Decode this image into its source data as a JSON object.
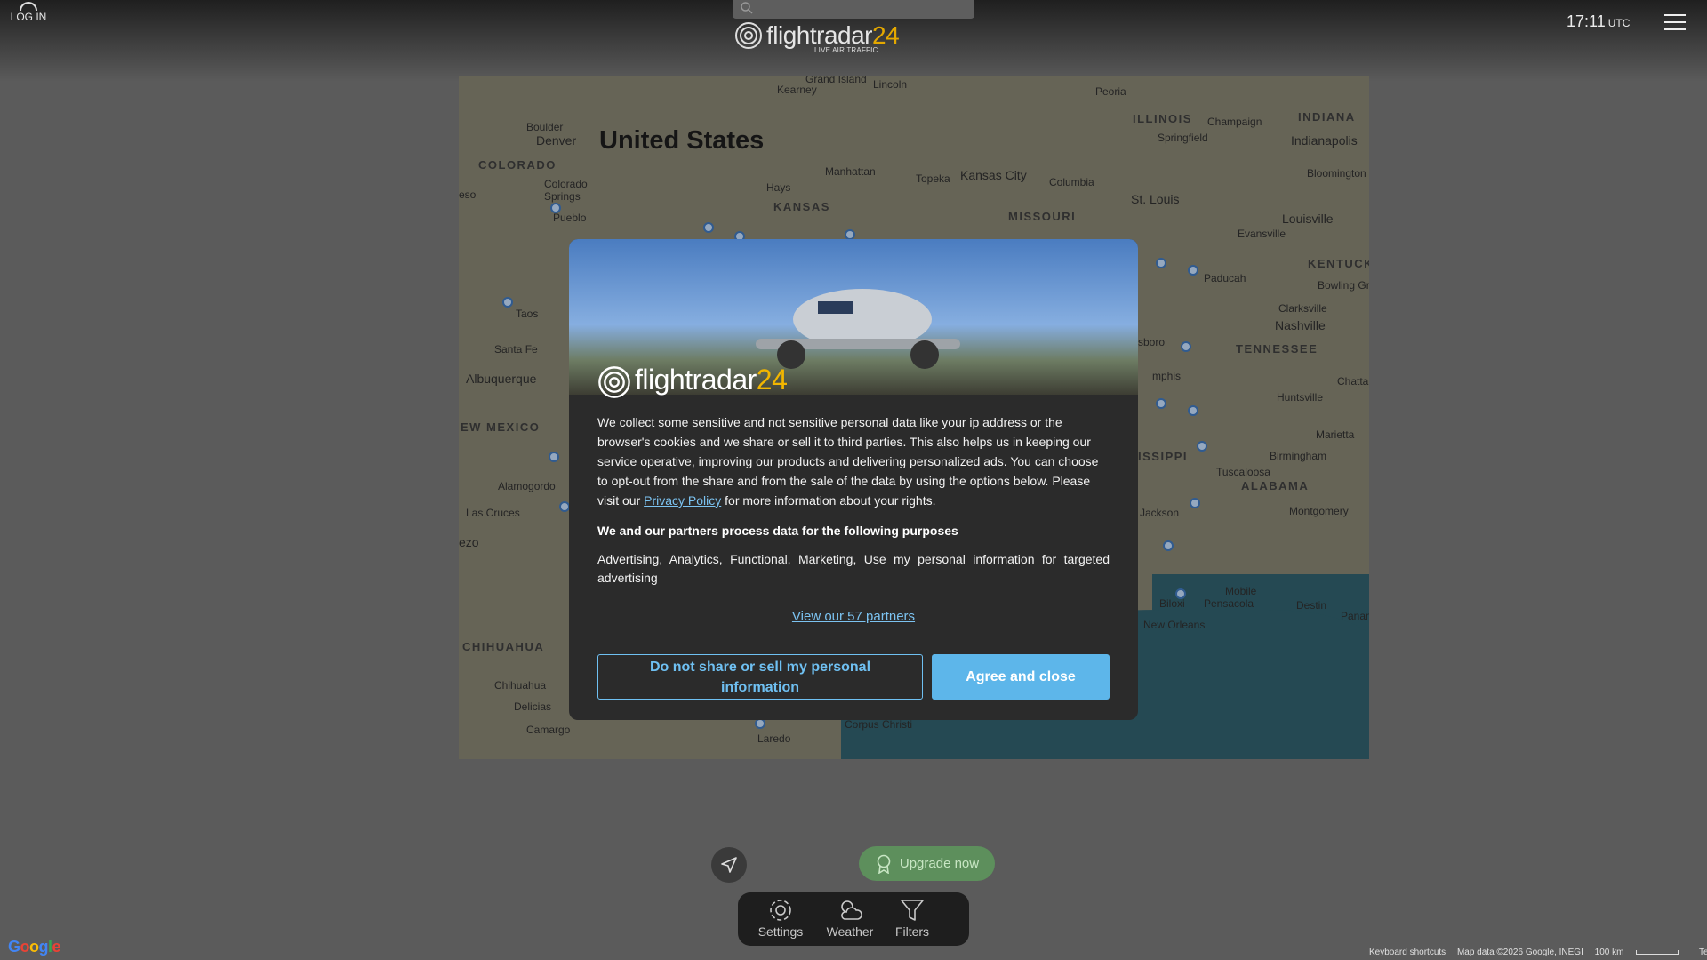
{
  "header": {
    "login_label": "LOG IN",
    "search": {
      "placeholder": ""
    },
    "logo": {
      "word": "flightradar",
      "number": "24",
      "subtitle": "LIVE AIR TRAFFIC"
    },
    "clock": {
      "time": "17:11",
      "timezone": "UTC"
    }
  },
  "map": {
    "country": "United States",
    "states": [
      {
        "name": "COLORADO"
      },
      {
        "name": "KANSAS"
      },
      {
        "name": "MISSOURI"
      },
      {
        "name": "ILLINOIS"
      },
      {
        "name": "INDIANA"
      },
      {
        "name": "KENTUCK"
      },
      {
        "name": "TENNESSEE"
      },
      {
        "name": "EW MEXICO"
      },
      {
        "name": "ISSIPPI"
      },
      {
        "name": "ALABAMA"
      },
      {
        "name": "CHIHUAHUA"
      }
    ],
    "cities": [
      {
        "name": "Grand Island"
      },
      {
        "name": "Kearney"
      },
      {
        "name": "Lincoln"
      },
      {
        "name": "Peoria"
      },
      {
        "name": "Champaign"
      },
      {
        "name": "Boulder"
      },
      {
        "name": "Denver"
      },
      {
        "name": "Springfield"
      },
      {
        "name": "Indianapolis"
      },
      {
        "name": "Manhattan"
      },
      {
        "name": "Kansas City"
      },
      {
        "name": "Topeka"
      },
      {
        "name": "Columbia"
      },
      {
        "name": "Bloomington"
      },
      {
        "name": "Colorado Springs"
      },
      {
        "name": "Hays"
      },
      {
        "name": "St. Louis"
      },
      {
        "name": "Louisville"
      },
      {
        "name": "Pueblo"
      },
      {
        "name": "Evansville"
      },
      {
        "name": "Paducah"
      },
      {
        "name": "Bowling Green"
      },
      {
        "name": "Taos"
      },
      {
        "name": "Clarksville"
      },
      {
        "name": "Nashville"
      },
      {
        "name": "Santa Fe"
      },
      {
        "name": "Albuquerque"
      },
      {
        "name": "mphis"
      },
      {
        "name": "Chatta"
      },
      {
        "name": "Huntsville"
      },
      {
        "name": "Marietta"
      },
      {
        "name": "Birmingham"
      },
      {
        "name": "Tuscaloosa"
      },
      {
        "name": "Alamogordo"
      },
      {
        "name": "Las Cruces"
      },
      {
        "name": "Jackson"
      },
      {
        "name": "Montgomery"
      },
      {
        "name": "Mobile"
      },
      {
        "name": "Biloxi"
      },
      {
        "name": "Pensacola"
      },
      {
        "name": "Destin"
      },
      {
        "name": "Panama C"
      },
      {
        "name": "New Orleans"
      },
      {
        "name": "Chihuahua"
      },
      {
        "name": "Delicias"
      },
      {
        "name": "Camargo"
      },
      {
        "name": "Laredo"
      },
      {
        "name": "Corpus Christi"
      },
      {
        "name": "eso"
      },
      {
        "name": "ezo"
      },
      {
        "name": "sboro"
      }
    ]
  },
  "consent_modal": {
    "logo": {
      "word": "flightradar",
      "number": "24"
    },
    "body_text": "We collect some sensitive and not sensitive personal data like your ip address or the browser's cookies and we share or sell it to third parties. This also helps us in keeping our service operative, improving our products and delivering personalized ads. You can choose to opt-out from the share and from the sale of the data by using the options below. Please visit our",
    "privacy_link": "Privacy Policy",
    "body_text_end": "for more information about your rights.",
    "purposes_heading": "We and our partners process data for the following purposes",
    "purposes_list": "Advertising, Analytics, Functional, Marketing, Use my personal information for targeted advertising",
    "partners_link": "View our 57 partners",
    "deny_button": "Do not share or sell my personal information",
    "agree_button": "Agree and close"
  },
  "controls": {
    "upgrade_label": "Upgrade now",
    "bottom_nav": [
      {
        "label": "Settings",
        "icon": "gear-icon"
      },
      {
        "label": "Weather",
        "icon": "weather-icon"
      },
      {
        "label": "Filters",
        "icon": "filter-icon"
      }
    ]
  },
  "footer": {
    "google": "Google",
    "keyboard_shortcuts": "Keyboard shortcuts",
    "map_data": "Map data ©2026 Google, INEGI",
    "scale": "100 km",
    "terms": "Terms"
  },
  "colors": {
    "accent": "#5db6ea",
    "brand_number": "#e4a800",
    "upgrade": "#5d8f5c"
  }
}
